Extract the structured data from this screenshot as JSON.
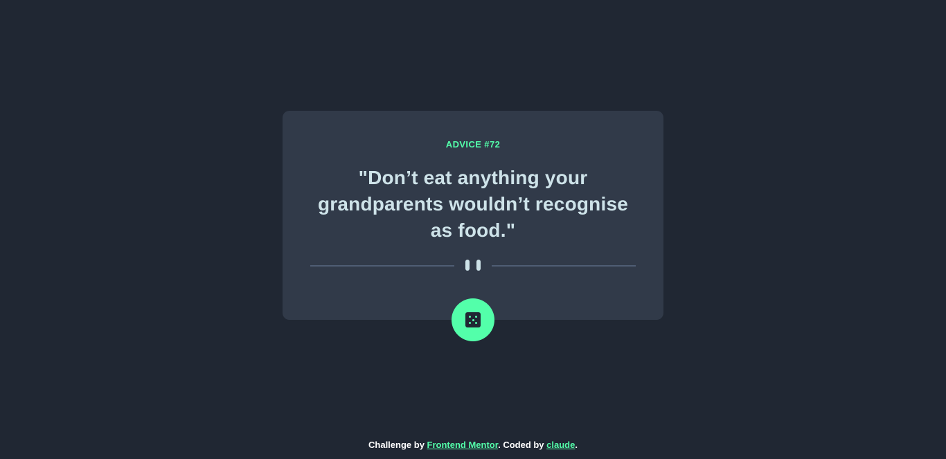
{
  "card": {
    "advice_id": "ADVICE #72",
    "advice_text": "\"Don’t eat anything your grandparents wouldn’t recognise as food.\""
  },
  "icons": {
    "divider": "pause-icon",
    "button": "dice-icon"
  },
  "footer": {
    "prefix": "Challenge by ",
    "link1": "Frontend Mentor",
    "middle": ". Coded by ",
    "link2": "claude",
    "suffix": "."
  },
  "colors": {
    "background": "#202733",
    "card": "#313A49",
    "accent": "#53FFAA",
    "text": "#CEE3E9",
    "divider": "#4F5D74"
  }
}
